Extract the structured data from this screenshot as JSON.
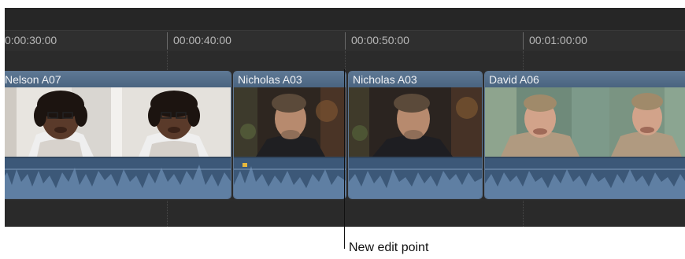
{
  "ruler": {
    "timecodes": [
      "0:00:30:00",
      "00:00:40:00",
      "00:00:50:00",
      "00:01:00:00"
    ]
  },
  "clips": [
    {
      "name": "Nelson A07"
    },
    {
      "name": "Nicholas A03"
    },
    {
      "name": "Nicholas A03"
    },
    {
      "name": "David A06"
    }
  ],
  "callout": {
    "label": "New edit point"
  },
  "colors": {
    "clip_header": "#5e7894",
    "audio": "#3c5878",
    "background": "#2b2b2b"
  }
}
